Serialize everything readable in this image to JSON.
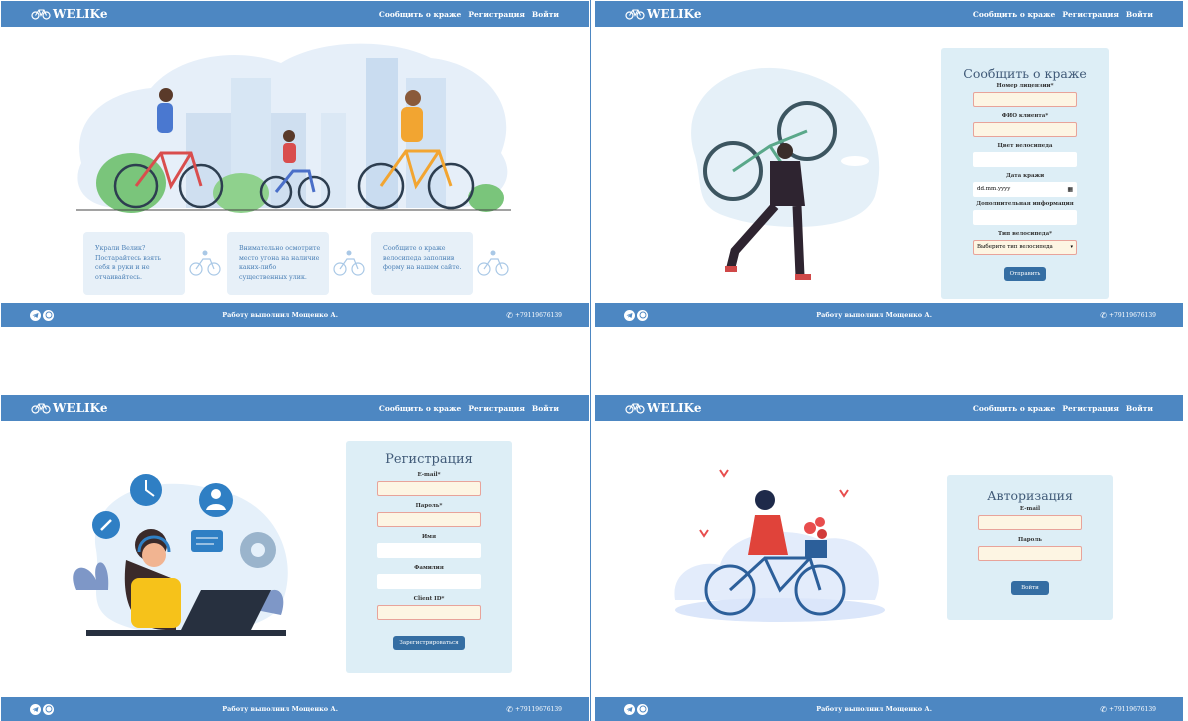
{
  "brand": "WELIKe",
  "nav": {
    "report": "Сообщить о краже",
    "register": "Регистрация",
    "login": "Войти"
  },
  "footer": {
    "credit": "Работу выполнил Мощенко А.",
    "phone": "+79119676139"
  },
  "home": {
    "cards": [
      {
        "text": "Украли Велик? Постарайтесь взять себя в руки и не отчаивайтесь."
      },
      {
        "text": "Внимательно осмотрите место угона на наличие каких-либо существенных улик."
      },
      {
        "text": "Сообщите о краже велосипеда заполнив форму на нашем сайте."
      }
    ]
  },
  "report": {
    "title": "Сообщить о краже",
    "fields": [
      {
        "label": "Номер лицензии*",
        "value": ""
      },
      {
        "label": "ФИО клиента*",
        "value": ""
      },
      {
        "label": "Цвет велосипеда",
        "value": ""
      },
      {
        "label": "Дата кражи",
        "value": "dd.mm.yyyy"
      },
      {
        "label": "Дополнительная информация",
        "value": ""
      },
      {
        "label": "Тип велосипеда*",
        "value": "Выберите тип велосипеда"
      }
    ],
    "submit": "Отправить"
  },
  "registration": {
    "title": "Регистрация",
    "fields": [
      {
        "label": "E-mail*"
      },
      {
        "label": "Пароль*"
      },
      {
        "label": "Имя"
      },
      {
        "label": "Фамилия"
      },
      {
        "label": "Client ID*"
      }
    ],
    "submit": "Зарегистрироваться"
  },
  "auth": {
    "title": "Авторизация",
    "fields": [
      {
        "label": "E-mail"
      },
      {
        "label": "Пароль"
      }
    ],
    "submit": "Войти"
  },
  "colors": {
    "nav": "#4d87c2",
    "card": "#ddeef6",
    "button": "#356ea3",
    "required_border": "#e8a39a"
  }
}
